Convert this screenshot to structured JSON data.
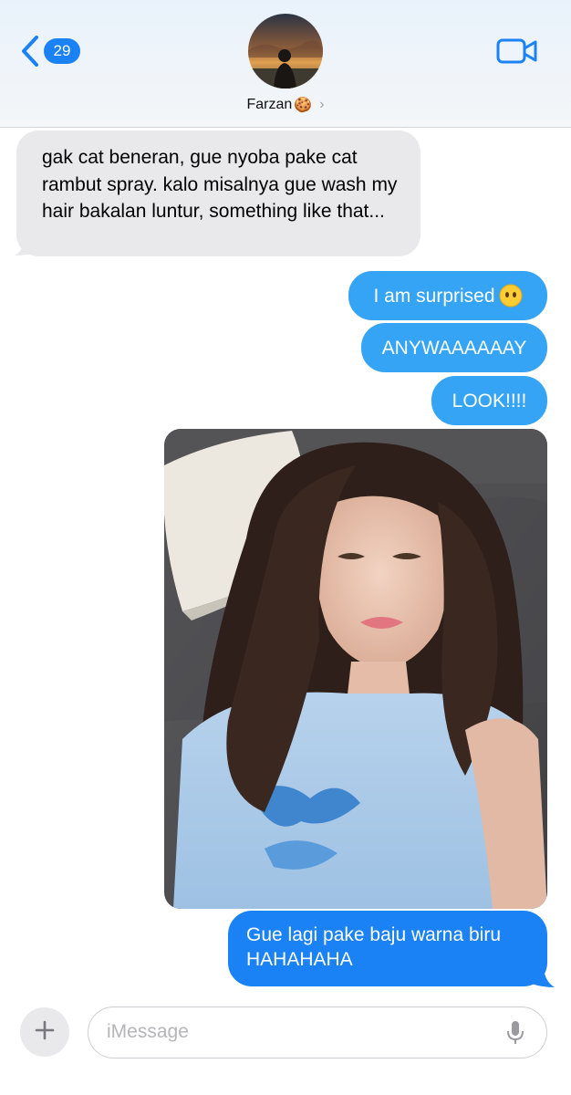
{
  "header": {
    "unread_count": "29",
    "contact_name": "Farzan",
    "contact_emoji": "🍪",
    "chevron": "›"
  },
  "messages": {
    "incoming_1": "gak cat beneran, gue nyoba pake cat rambut spray. kalo misalnya gue wash my hair bakalan luntur, something like that...",
    "outgoing_1": "I am surprised",
    "outgoing_2": "ANYWAAAAAAY",
    "outgoing_3": "LOOK!!!!",
    "outgoing_4": "Gue lagi pake baju warna biru HAHAHAHA"
  },
  "composer": {
    "placeholder": "iMessage",
    "value": ""
  },
  "icons": {
    "back": "chevron-left-icon",
    "video": "video-camera-icon",
    "plus": "plus-icon",
    "mic": "microphone-icon",
    "emoji": "face-without-mouth-emoji"
  },
  "colors": {
    "imessage_blue": "#1b82f6",
    "sent_light_blue": "#35a4f5",
    "received_gray": "#e9e9eb"
  }
}
